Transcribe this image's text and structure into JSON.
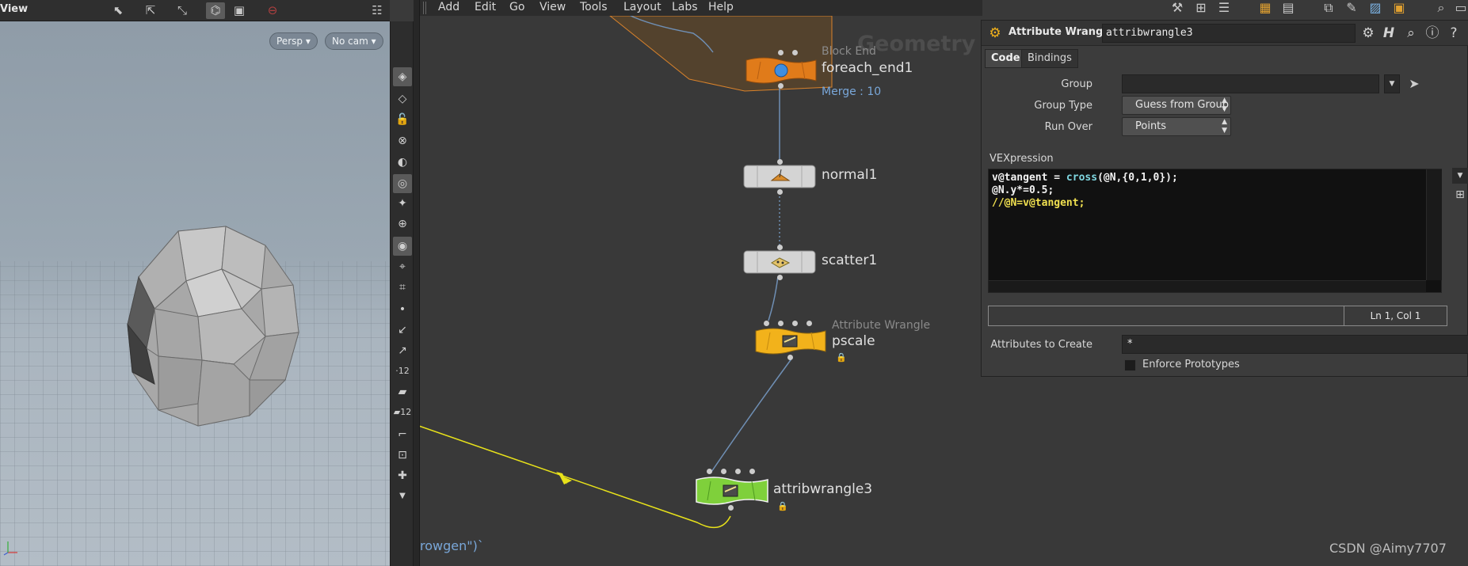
{
  "viewport": {
    "title": "View",
    "camera_menu": "Persp",
    "cam_menu": "No cam"
  },
  "menubar": {
    "items": [
      "Add",
      "Edit",
      "Go",
      "View",
      "Tools",
      "Layout",
      "Labs",
      "Help"
    ]
  },
  "network": {
    "context_watermark": "Geometry",
    "nodes": [
      {
        "type": "Block End",
        "name": "foreach_end1",
        "info": "Merge : 10"
      },
      {
        "type": "",
        "name": "normal1"
      },
      {
        "type": "",
        "name": "scatter1"
      },
      {
        "type": "Attribute Wrangle",
        "name": "pscale"
      },
      {
        "type": "",
        "name": "attribwrangle3"
      }
    ],
    "bottom_text": "rowgen\")`",
    "credit": "CSDN @Aimy7707"
  },
  "params": {
    "node_type": "Attribute Wrangle",
    "node_name": "attribwrangle3",
    "tabs": [
      "Code",
      "Bindings"
    ],
    "group_label": "Group",
    "group_value": "",
    "group_type_label": "Group Type",
    "group_type_value": "Guess from Group",
    "run_over_label": "Run Over",
    "run_over_value": "Points",
    "vex_label": "VEXpression",
    "code": {
      "line1_a": "v@tangent = ",
      "line1_fn": "cross",
      "line1_b": "(@N,{0,1,0});",
      "line2": "@N.y*=0.5;",
      "line3": "//@N=v@tangent;"
    },
    "status_pos": "Ln 1, Col 1",
    "attrs_label": "Attributes to Create",
    "attrs_value": "*",
    "enforce_label": "Enforce Prototypes"
  },
  "colors": {
    "block_end": "#e07b1a",
    "wrangle_orange": "#f2b21b",
    "wrangle_green": "#7fd03b",
    "wire_blue": "#6f8fb4",
    "wire_yellow": "#e8e21a"
  }
}
